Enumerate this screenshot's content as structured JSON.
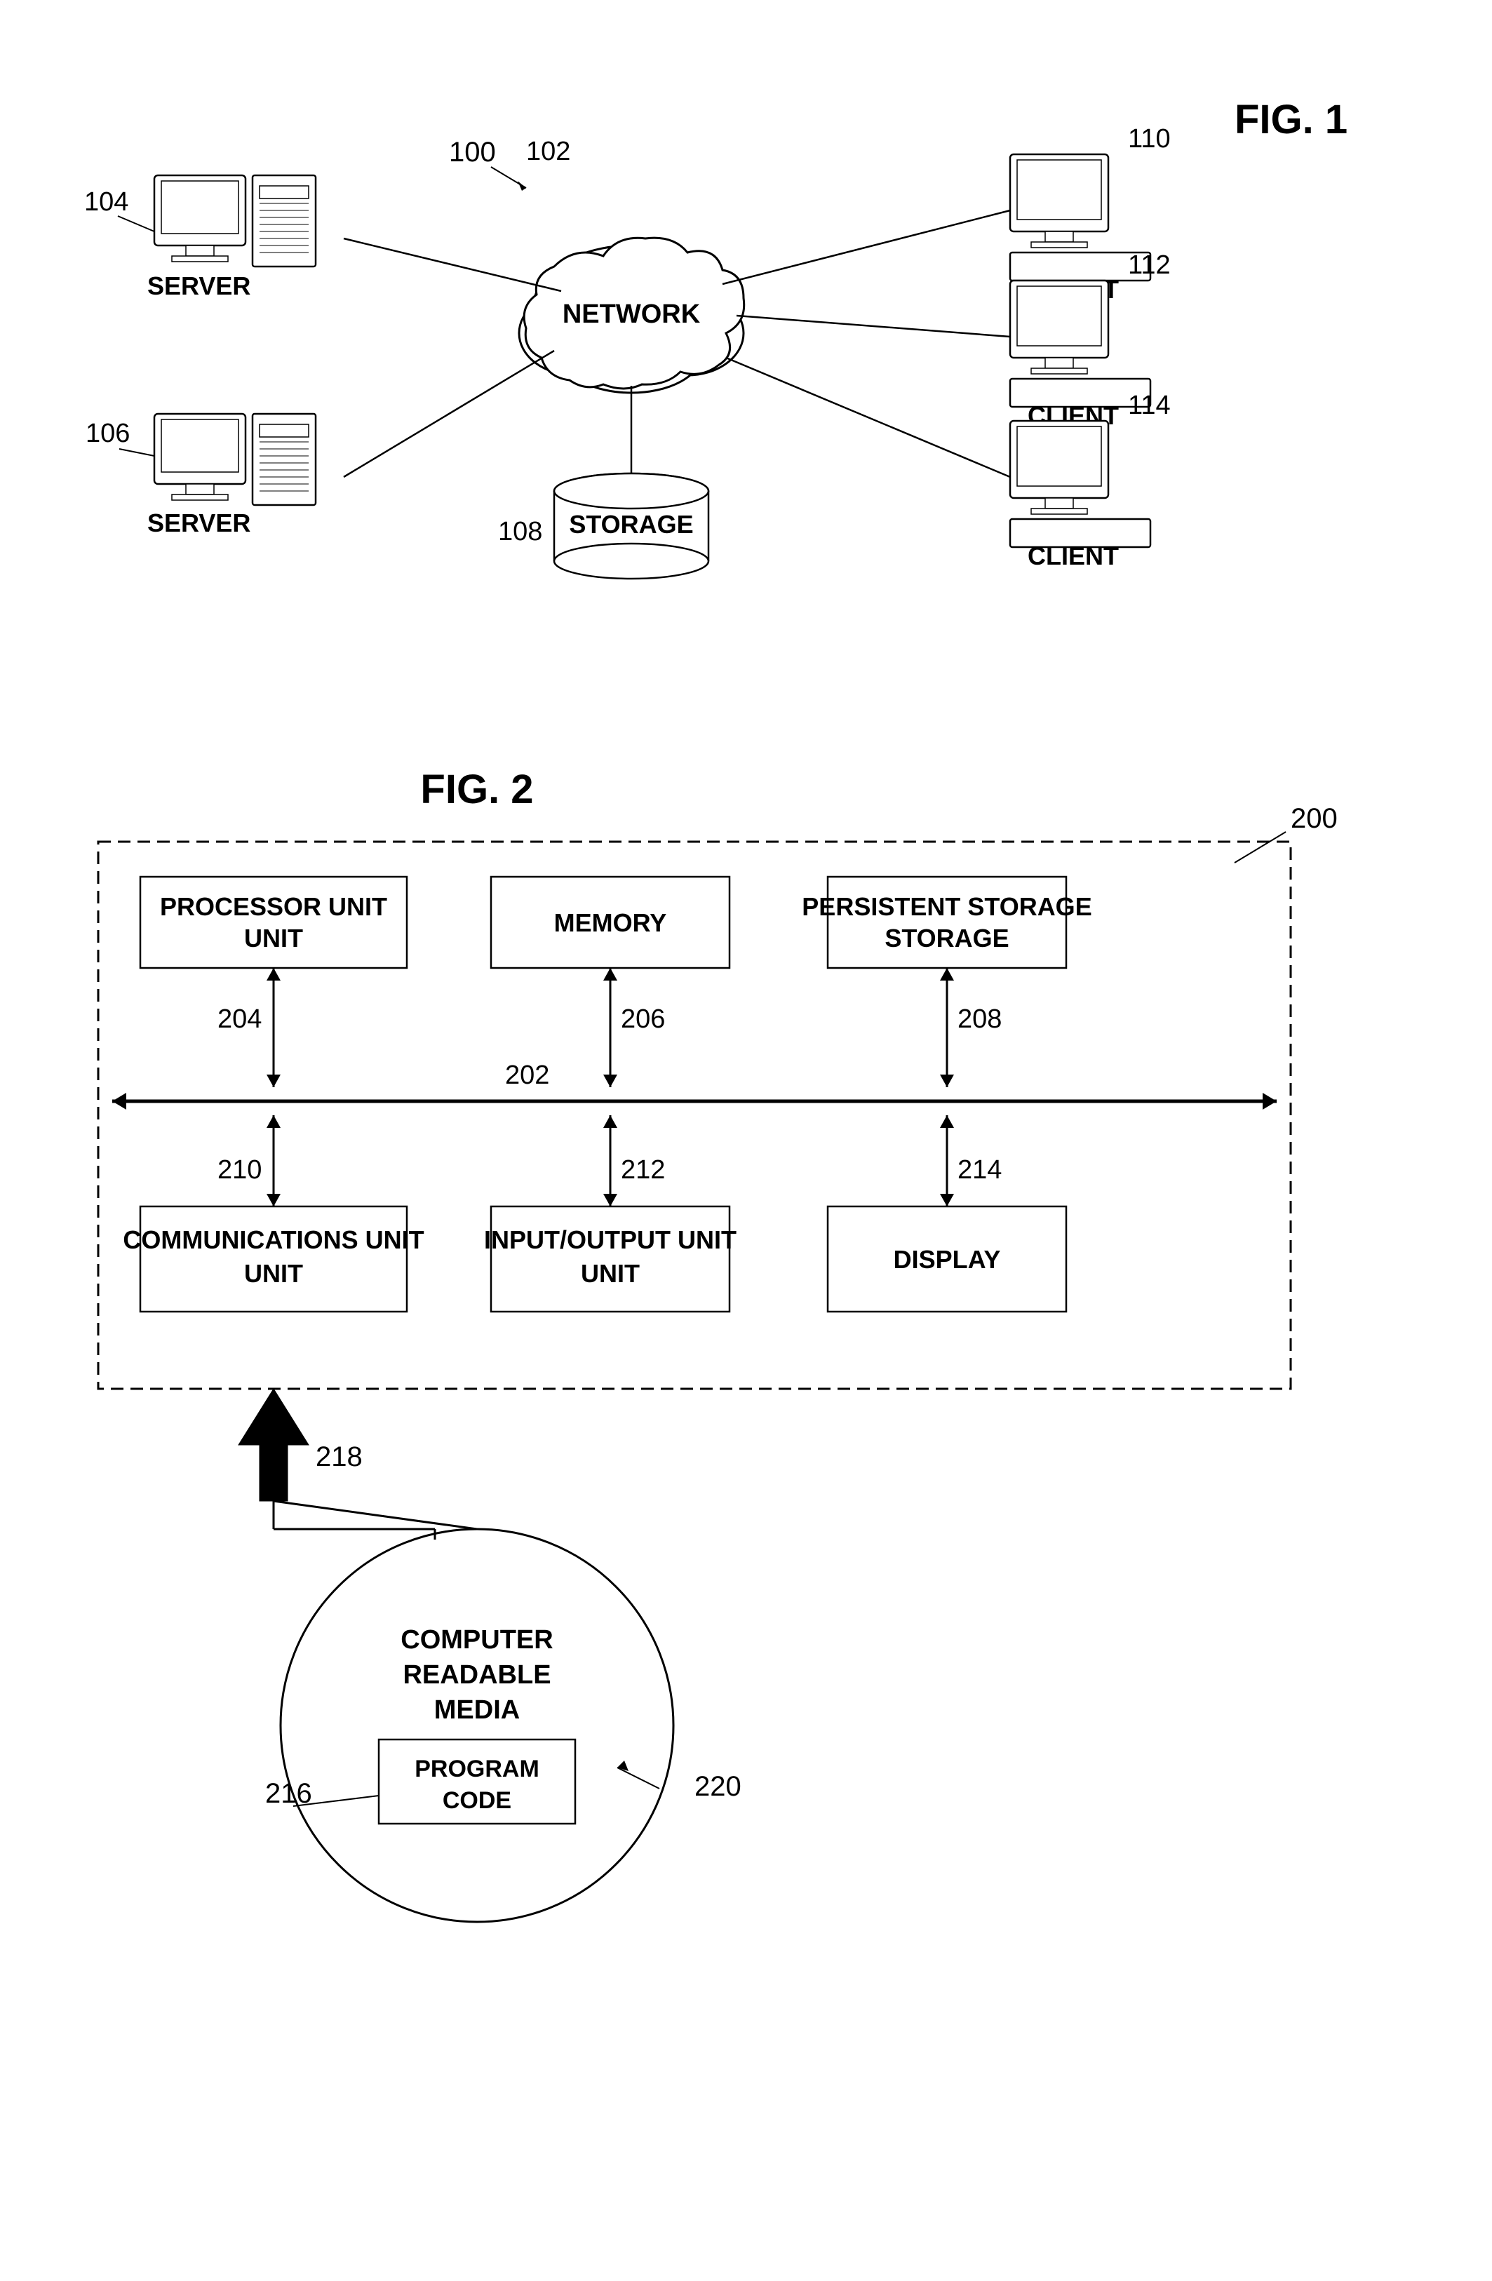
{
  "fig1": {
    "label": "FIG. 1",
    "ref_100": "100",
    "ref_102": "102",
    "ref_104": "104",
    "ref_106": "106",
    "ref_108": "108",
    "ref_110": "110",
    "ref_112": "112",
    "ref_114": "114",
    "network_label": "NETWORK",
    "storage_label": "STORAGE",
    "server_label_1": "SERVER",
    "server_label_2": "SERVER",
    "client_label_1": "CLIENT",
    "client_label_2": "CLIENT",
    "client_label_3": "CLIENT"
  },
  "fig2": {
    "label": "FIG. 2",
    "ref_200": "200",
    "ref_202": "202",
    "ref_204": "204",
    "ref_206": "206",
    "ref_208": "208",
    "ref_210": "210",
    "ref_212": "212",
    "ref_214": "214",
    "ref_216": "216",
    "ref_218": "218",
    "ref_220": "220",
    "processor_unit": "PROCESSOR UNIT",
    "memory": "MEMORY",
    "persistent_storage": "PERSISTENT STORAGE",
    "communications_unit": "COMMUNICATIONS UNIT",
    "input_output_unit": "INPUT/OUTPUT UNIT",
    "display": "DISPLAY",
    "computer_readable_media": "COMPUTER READABLE MEDIA",
    "program_code": "PROGRAM CODE"
  }
}
